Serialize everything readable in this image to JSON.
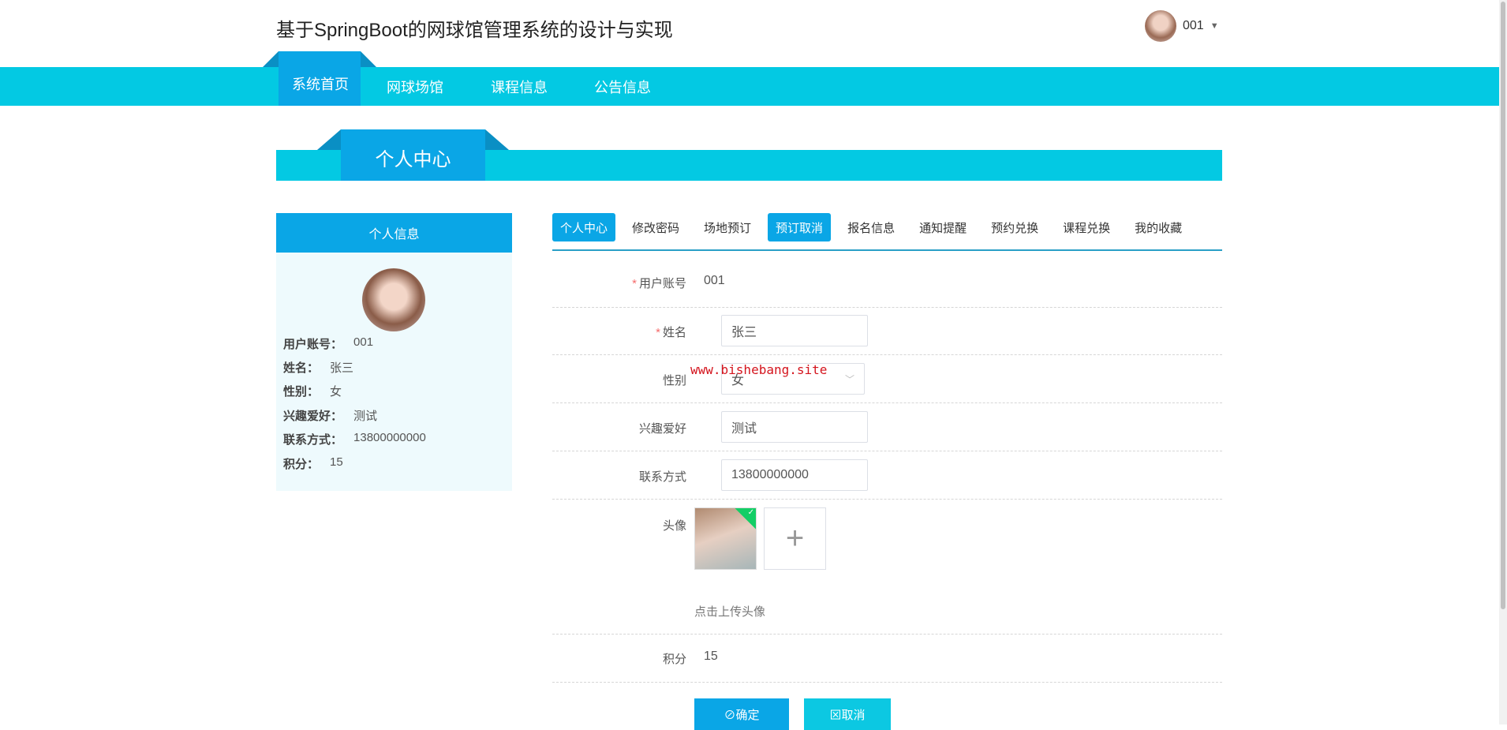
{
  "header": {
    "title": "基于SpringBoot的网球馆管理系统的设计与实现",
    "user": "001"
  },
  "nav": [
    "系统首页",
    "网球场馆",
    "课程信息",
    "公告信息"
  ],
  "banner": "个人中心",
  "panel": {
    "title": "个人信息",
    "rows": [
      {
        "k": "用户账号：",
        "v": "001"
      },
      {
        "k": "姓名：",
        "v": "张三"
      },
      {
        "k": "性别：",
        "v": "女"
      },
      {
        "k": "兴趣爱好：",
        "v": "测试"
      },
      {
        "k": "联系方式：",
        "v": "13800000000"
      },
      {
        "k": "积分：",
        "v": "15"
      }
    ]
  },
  "tabs": [
    "个人中心",
    "修改密码",
    "场地预订",
    "预订取消",
    "报名信息",
    "通知提醒",
    "预约兑换",
    "课程兑换",
    "我的收藏"
  ],
  "form": {
    "account_label": "用户账号",
    "account": "001",
    "name_label": "姓名",
    "name": "张三",
    "gender_label": "性别",
    "gender": "女",
    "hobby_label": "兴趣爱好",
    "hobby": "测试",
    "phone_label": "联系方式",
    "phone": "13800000000",
    "avatar_label": "头像",
    "avatar_hint": "点击上传头像",
    "points_label": "积分",
    "points": "15",
    "required_mark": "*",
    "confirm": "⊘确定",
    "cancel": "⊠取消"
  },
  "watermark": "www.bishebang.site",
  "colors": {
    "nav": "#03c9e3",
    "active": "#0aa6e6"
  }
}
